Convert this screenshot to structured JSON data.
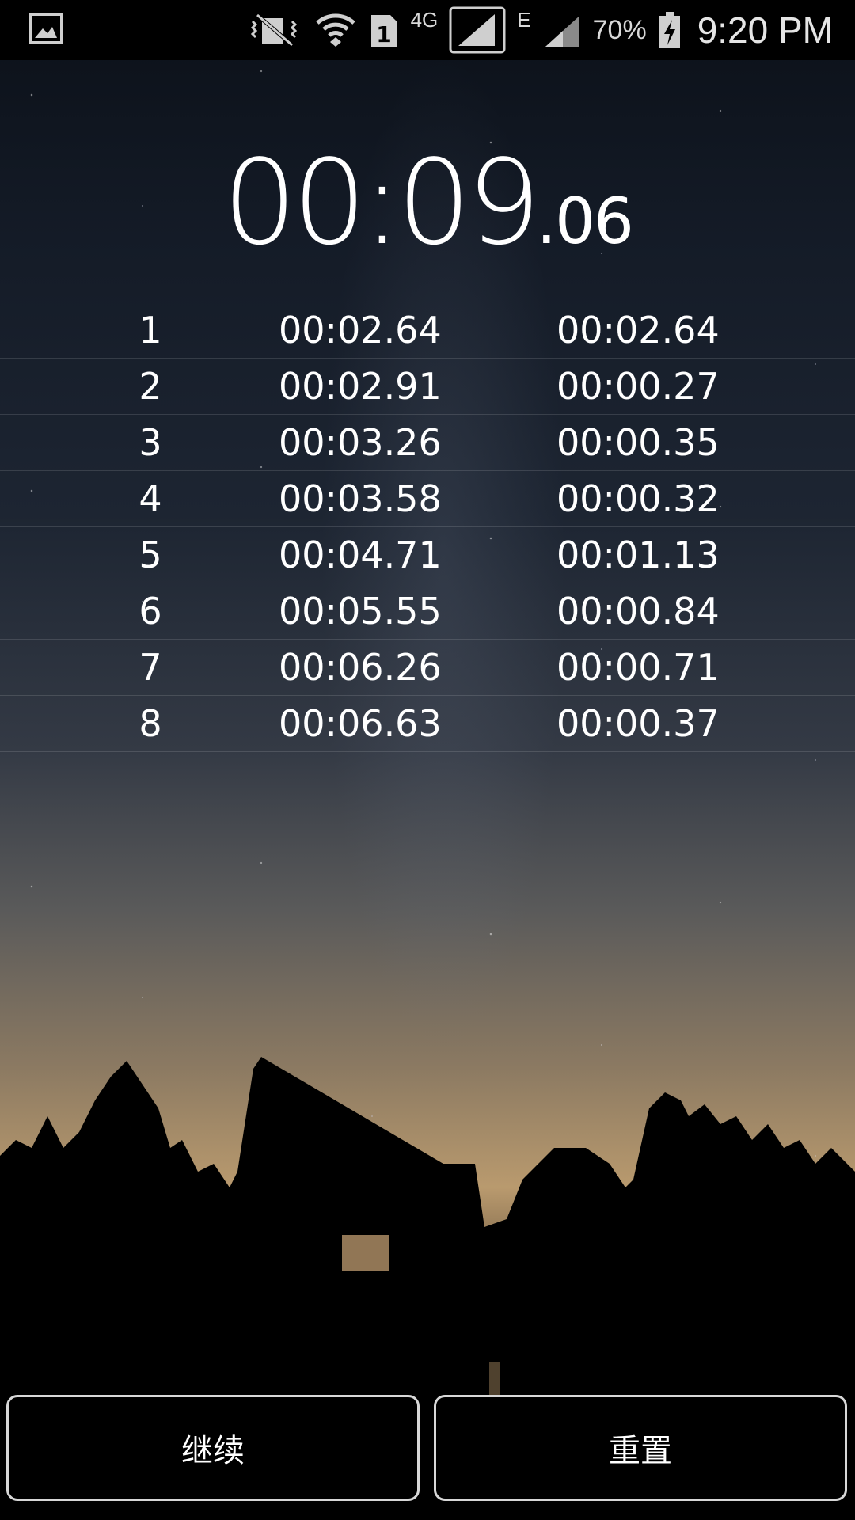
{
  "status_bar": {
    "left_icon": "image-icon",
    "icons": [
      "mute-icon",
      "wifi-icon",
      "sim-1-icon",
      "signal-icon",
      "signal-icon"
    ],
    "network_4g": "4G",
    "network_e": "E",
    "battery_percent": "70%",
    "battery_icon": "battery-charging-icon",
    "time": "9:20 PM"
  },
  "timer": {
    "main": "00:09",
    "fraction": ".06"
  },
  "laps": [
    {
      "number": "1",
      "total": "00:02.64",
      "split": "00:02.64"
    },
    {
      "number": "2",
      "total": "00:02.91",
      "split": "00:00.27"
    },
    {
      "number": "3",
      "total": "00:03.26",
      "split": "00:00.35"
    },
    {
      "number": "4",
      "total": "00:03.58",
      "split": "00:00.32"
    },
    {
      "number": "5",
      "total": "00:04.71",
      "split": "00:01.13"
    },
    {
      "number": "6",
      "total": "00:05.55",
      "split": "00:00.84"
    },
    {
      "number": "7",
      "total": "00:06.26",
      "split": "00:00.71"
    },
    {
      "number": "8",
      "total": "00:06.63",
      "split": "00:00.37"
    }
  ],
  "buttons": {
    "continue_label": "继续",
    "reset_label": "重置"
  }
}
